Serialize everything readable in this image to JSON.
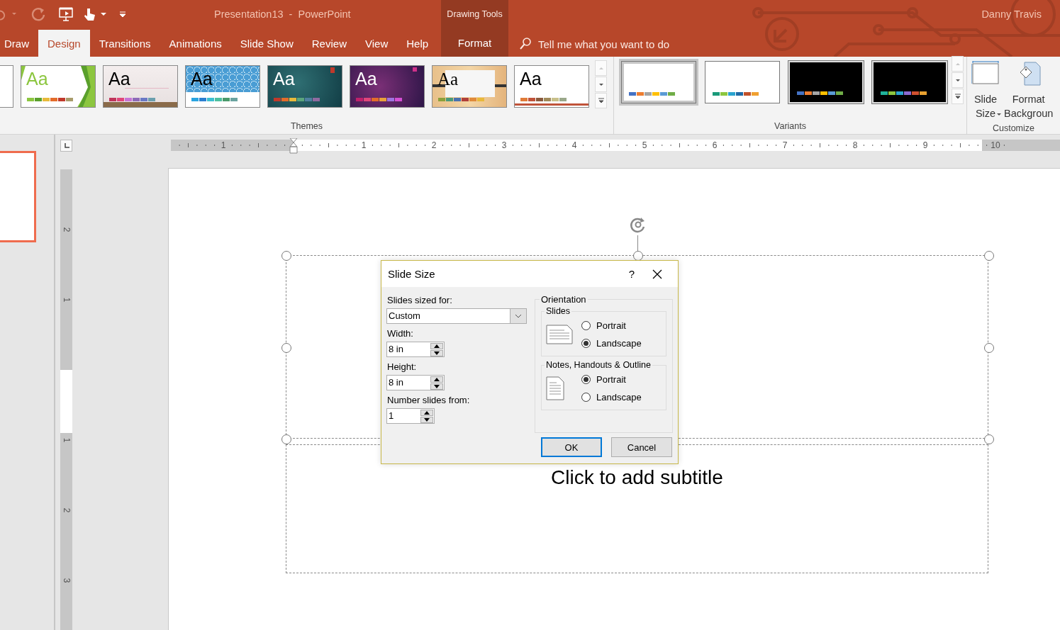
{
  "window": {
    "title": "Presentation13  -  PowerPoint",
    "context_group": "Drawing Tools",
    "user": "Danny Travis"
  },
  "tabs": [
    {
      "label": "Draw",
      "selected": false,
      "kind": "normal"
    },
    {
      "label": "Design",
      "selected": true,
      "kind": "normal"
    },
    {
      "label": "Transitions",
      "selected": false,
      "kind": "normal"
    },
    {
      "label": "Animations",
      "selected": false,
      "kind": "normal"
    },
    {
      "label": "Slide Show",
      "selected": false,
      "kind": "normal"
    },
    {
      "label": "Review",
      "selected": false,
      "kind": "normal"
    },
    {
      "label": "View",
      "selected": false,
      "kind": "normal"
    },
    {
      "label": "Help",
      "selected": false,
      "kind": "normal"
    },
    {
      "label": "Format",
      "selected": false,
      "kind": "contextual"
    }
  ],
  "search": {
    "placeholder": "Tell me what you want to do"
  },
  "themes": {
    "label": "Themes",
    "items": [
      {
        "kind": "blank"
      },
      {
        "kind": "facet",
        "sample": "Aa",
        "swatches": [
          {
            "color": "#8cc63f"
          },
          {
            "color": "#5aa02c"
          },
          {
            "color": "#e8b93a"
          },
          {
            "color": "#e36c2a"
          },
          {
            "color": "#c0392b"
          },
          {
            "color": "#a89c6b"
          }
        ]
      },
      {
        "kind": "wood",
        "sample": "Aa",
        "swatches": [
          {
            "color": "#c0345a"
          },
          {
            "color": "#e0457a"
          },
          {
            "color": "#c774d6"
          },
          {
            "color": "#8e6ab8"
          },
          {
            "color": "#6a79c5"
          },
          {
            "color": "#6b9fae"
          }
        ]
      },
      {
        "kind": "pattern",
        "sample": "Aa",
        "swatches": [
          {
            "color": "#2aa4e0"
          },
          {
            "color": "#2b7fd1"
          },
          {
            "color": "#3cc0d0"
          },
          {
            "color": "#4dbf9f"
          },
          {
            "color": "#4a9a6b"
          },
          {
            "color": "#6aa3a0"
          }
        ]
      },
      {
        "kind": "teal",
        "sample": "Aa",
        "swatches": [
          {
            "color": "#c0392b"
          },
          {
            "color": "#e36c2a"
          },
          {
            "color": "#e8b93a"
          },
          {
            "color": "#5aa57c"
          },
          {
            "color": "#4f7fa0"
          },
          {
            "color": "#8f6aa0"
          }
        ]
      },
      {
        "kind": "purple",
        "sample": "Aa",
        "swatches": [
          {
            "color": "#c0206b"
          },
          {
            "color": "#e0457a"
          },
          {
            "color": "#e36c2a"
          },
          {
            "color": "#e8a03a"
          },
          {
            "color": "#9e74e0"
          },
          {
            "color": "#d44fd4"
          }
        ]
      },
      {
        "kind": "paper",
        "sample": "Aa",
        "swatches": [
          {
            "color": "#8ca03a"
          },
          {
            "color": "#4a9a7a"
          },
          {
            "color": "#4a72b0"
          },
          {
            "color": "#b0403a"
          },
          {
            "color": "#e08a3a"
          },
          {
            "color": "#e8b93a"
          }
        ]
      },
      {
        "kind": "simple",
        "sample": "Aa",
        "swatches": [
          {
            "color": "#e07b39"
          },
          {
            "color": "#c0533a"
          },
          {
            "color": "#8a5a3c"
          },
          {
            "color": "#a08a5a"
          },
          {
            "color": "#c8c08a"
          },
          {
            "color": "#9aa88a"
          }
        ]
      }
    ]
  },
  "variants": {
    "label": "Variants",
    "items": [
      {
        "kind": "light",
        "selected": true,
        "swatches": [
          {
            "color": "#4472c4"
          },
          {
            "color": "#ed7d31"
          },
          {
            "color": "#a5a5a5"
          },
          {
            "color": "#ffc000"
          },
          {
            "color": "#5b9bd5"
          },
          {
            "color": "#70ad47"
          }
        ]
      },
      {
        "kind": "light",
        "selected": false,
        "swatches": [
          {
            "color": "#1a9a7a"
          },
          {
            "color": "#8cc63f"
          },
          {
            "color": "#2aa4d0"
          },
          {
            "color": "#1f6aa5"
          },
          {
            "color": "#c0502a"
          },
          {
            "color": "#f0a030"
          }
        ]
      },
      {
        "kind": "dark",
        "selected": false,
        "swatches": [
          {
            "color": "#4472c4"
          },
          {
            "color": "#ed7d31"
          },
          {
            "color": "#a5a5a5"
          },
          {
            "color": "#ffc000"
          },
          {
            "color": "#5b9bd5"
          },
          {
            "color": "#70ad47"
          }
        ]
      },
      {
        "kind": "dark",
        "selected": false,
        "swatches": [
          {
            "color": "#1fb29a"
          },
          {
            "color": "#8cc63f"
          },
          {
            "color": "#2aa4d0"
          },
          {
            "color": "#8a6ad0"
          },
          {
            "color": "#d05030"
          },
          {
            "color": "#e8a030"
          }
        ]
      }
    ]
  },
  "customize": {
    "label": "Customize",
    "buttons": [
      {
        "kind": "slide-size",
        "lines": [
          "Slide",
          "Size"
        ]
      },
      {
        "kind": "format-background",
        "lines": [
          "Format",
          "Backgroun"
        ]
      }
    ]
  },
  "rulers": {
    "horizontal": {
      "before": [
        "1"
      ],
      "after": [
        "1",
        "2",
        "3",
        "4",
        "5",
        "6",
        "7",
        "8",
        "9",
        "10"
      ]
    },
    "vertical": {
      "before": [
        "2",
        "1"
      ],
      "after": [
        "1",
        "2",
        "3"
      ]
    }
  },
  "slide": {
    "subtitle": "Click to add subtitle"
  },
  "dialog": {
    "title": "Slide Size",
    "help": "?",
    "sized_for": {
      "label": "Slides sized for:",
      "value": "Custom"
    },
    "fields": [
      {
        "label": "Width:",
        "value": "8 in"
      },
      {
        "label": "Height:",
        "value": "8 in"
      },
      {
        "label": "Number slides from:",
        "value": "1"
      }
    ],
    "orientation": {
      "label": "Orientation",
      "groups": [
        {
          "label": "Slides",
          "kind": "landscape",
          "options": [
            {
              "label": "Portrait",
              "selected": false
            },
            {
              "label": "Landscape",
              "selected": true
            }
          ]
        },
        {
          "label": "Notes, Handouts & Outline",
          "kind": "portrait",
          "options": [
            {
              "label": "Portrait",
              "selected": true
            },
            {
              "label": "Landscape",
              "selected": false
            }
          ]
        }
      ]
    },
    "buttons": [
      {
        "label": "OK",
        "default": true
      },
      {
        "label": "Cancel",
        "default": false
      }
    ]
  }
}
